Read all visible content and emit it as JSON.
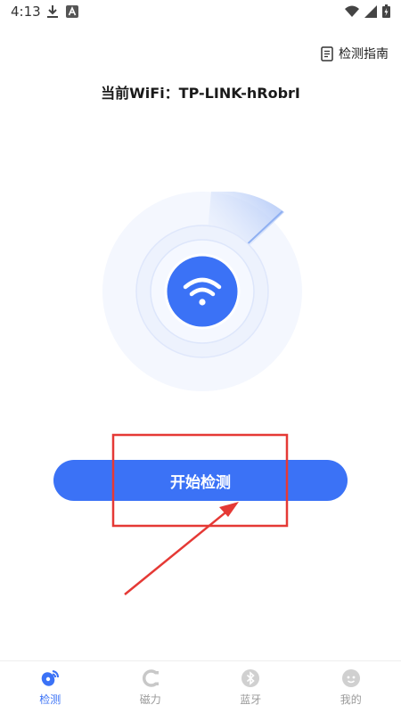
{
  "status_bar": {
    "time": "4:13",
    "icons": [
      "download-icon",
      "app-a-icon",
      "wifi-icon",
      "signal-icon",
      "battery-icon"
    ]
  },
  "guide": {
    "label": "检测指南",
    "icon": "document-icon"
  },
  "wifi": {
    "title": "当前WiFi：TP-LINK-hRobrI"
  },
  "start_button": {
    "label": "开始检测"
  },
  "nav": {
    "items": [
      {
        "label": "检测",
        "icon": "radar-icon",
        "active": true
      },
      {
        "label": "磁力",
        "icon": "magnet-icon",
        "active": false
      },
      {
        "label": "蓝牙",
        "icon": "bluetooth-icon",
        "active": false
      },
      {
        "label": "我的",
        "icon": "profile-icon",
        "active": false
      }
    ]
  },
  "colors": {
    "accent": "#3b72f6",
    "annotation": "#e53935",
    "radar_ring": "#eef2fd"
  }
}
